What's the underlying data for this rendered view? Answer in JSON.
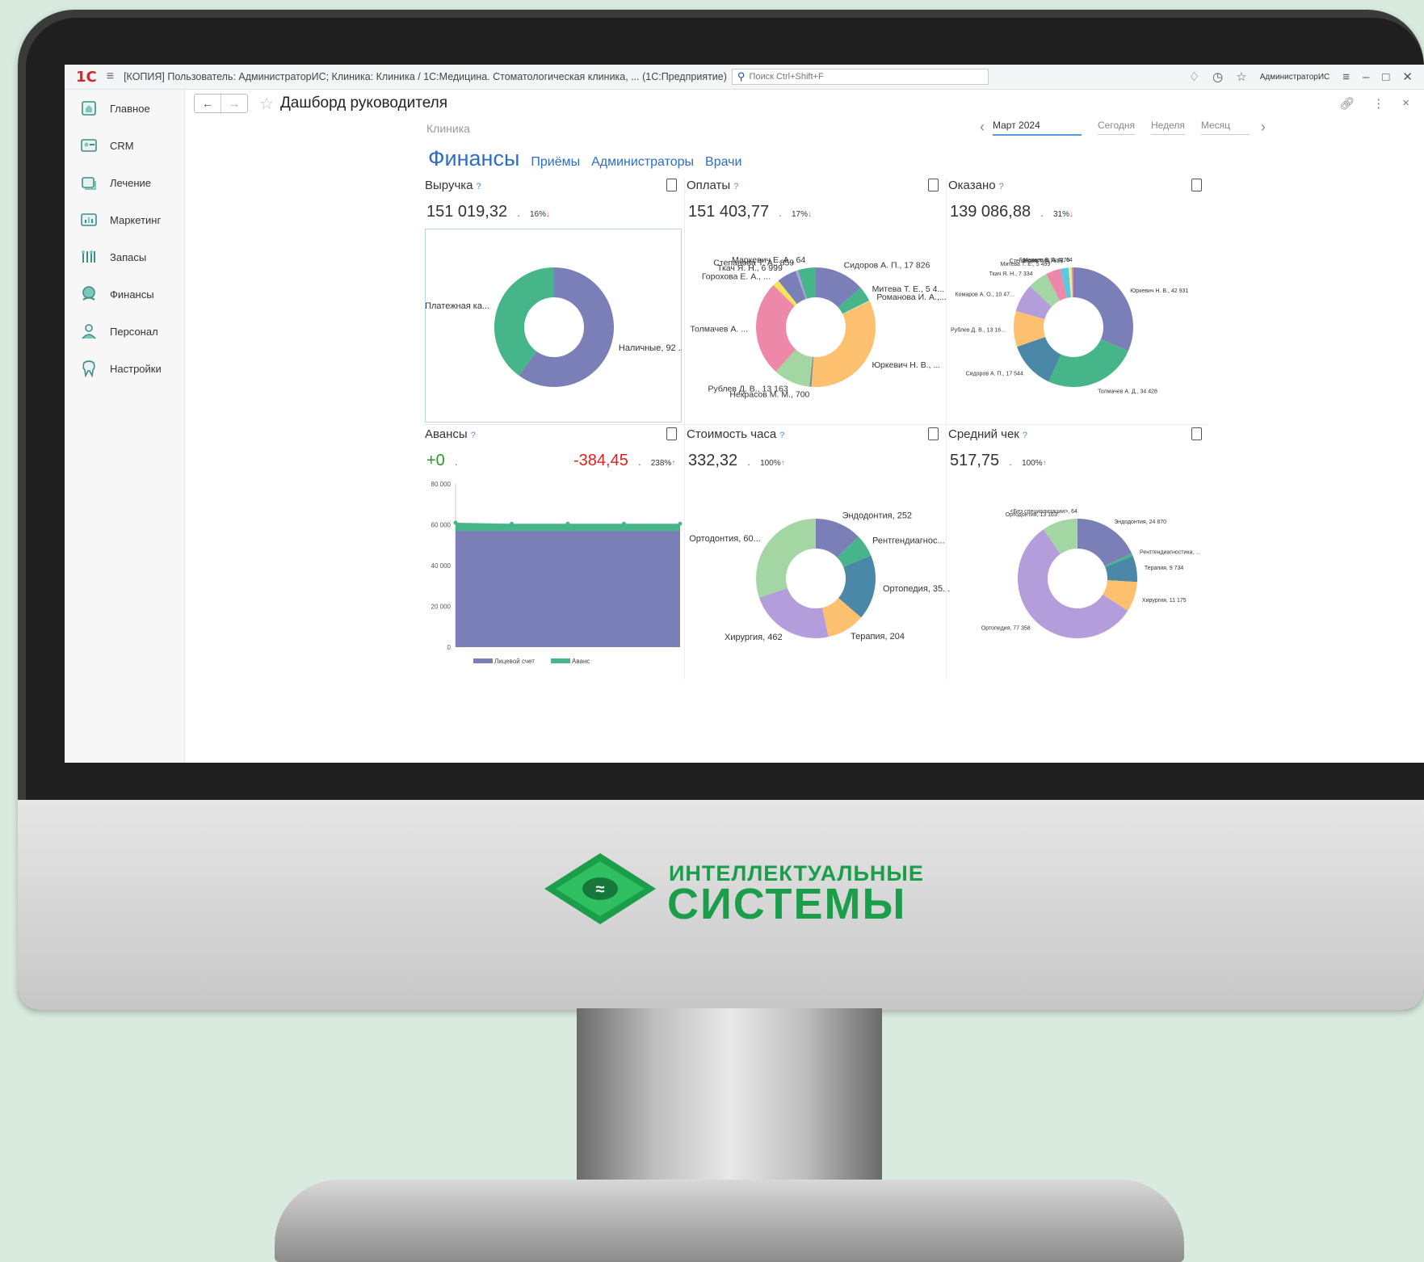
{
  "window": {
    "logo": "1С",
    "title": "[КОПИЯ] Пользователь: АдминистраторИС; Клиника: Клиника / 1С:Медицина. Стоматологическая клиника, ...  (1С:Предприятие)",
    "search_placeholder": "Поиск Ctrl+Shift+F",
    "user": "АдминистраторИС"
  },
  "sidebar": {
    "items": [
      {
        "label": "Главное",
        "icon": "home-icon"
      },
      {
        "label": "CRM",
        "icon": "crm-icon"
      },
      {
        "label": "Лечение",
        "icon": "treatment-icon"
      },
      {
        "label": "Маркетинг",
        "icon": "marketing-icon"
      },
      {
        "label": "Запасы",
        "icon": "stock-icon"
      },
      {
        "label": "Финансы",
        "icon": "finance-icon"
      },
      {
        "label": "Персонал",
        "icon": "staff-icon"
      },
      {
        "label": "Настройки",
        "icon": "settings-icon"
      }
    ]
  },
  "page": {
    "title": "Дашборд руководителя",
    "clinic": "Клиника",
    "period": {
      "selected": "Март 2024",
      "options": [
        "Сегодня",
        "Неделя",
        "Месяц"
      ]
    },
    "tabs": [
      "Финансы",
      "Приёмы",
      "Администраторы",
      "Врачи"
    ]
  },
  "colors": {
    "purple": "#7b7fb8",
    "green": "#47b58a",
    "orange": "#fdc06f",
    "pink": "#ee88a8",
    "lightgreen": "#a4d6a4",
    "teal": "#4b88a8",
    "lilac": "#b49ddb",
    "yellow": "#f5e45a",
    "accent": "#2a6ec8",
    "brand": "#1a9e4a"
  },
  "panels": {
    "revenue": {
      "title": "Выручка",
      "value": "151 019,32",
      "percent": "16%",
      "trend": "down"
    },
    "payments": {
      "title": "Оплаты",
      "value": "151 403,77",
      "percent": "17%",
      "trend": "down"
    },
    "rendered": {
      "title": "Оказано",
      "value": "139 086,88",
      "percent": "31%",
      "trend": "down"
    },
    "advances": {
      "title": "Авансы",
      "value": "+0",
      "value2": "-384,45",
      "percent": "238%",
      "trend": "up"
    },
    "hour_cost": {
      "title": "Стоимость часа",
      "value": "332,32",
      "percent": "100%",
      "trend": "up"
    },
    "avg_check": {
      "title": "Средний чек",
      "value": "517,75",
      "percent": "100%",
      "trend": "up"
    }
  },
  "chart_data": [
    {
      "id": "revenue",
      "type": "pie",
      "series": [
        {
          "name": "Наличные, 92 ...",
          "value": 60,
          "color": "#7b7fb8"
        },
        {
          "name": "Платежная ка...",
          "value": 40,
          "color": "#47b58a"
        }
      ]
    },
    {
      "id": "payments",
      "type": "pie",
      "series": [
        {
          "name": "Сидоров А. П., 17 826",
          "value": 17826,
          "color": "#7b7fb8"
        },
        {
          "name": "Митева Т. Е., 5 4...",
          "value": 5400,
          "color": "#47b58a"
        },
        {
          "name": "Романова И. А.,...",
          "value": 300,
          "color": "#d0d0d0"
        },
        {
          "name": "Юркевич Н. В., ...",
          "value": 44000,
          "color": "#fdc06f"
        },
        {
          "name": "Некрасов М. М., 700",
          "value": 700,
          "color": "#8a8a8a"
        },
        {
          "name": "Рублев Д. В., 13 163",
          "value": 13163,
          "color": "#a4d6a4"
        },
        {
          "name": "Толмачев А. ...",
          "value": 34000,
          "color": "#ee88a8"
        },
        {
          "name": "Горохова Е. А., ...",
          "value": 2300,
          "color": "#f5e45a"
        },
        {
          "name": "Ткач Я. Н., 6 999",
          "value": 6999,
          "color": "#7b7fb8"
        },
        {
          "name": "Степанова Т. А., 859",
          "value": 859,
          "color": "#b49ddb"
        },
        {
          "name": "Маркевич Е. А., 64",
          "value": 6400,
          "color": "#47b58a"
        }
      ]
    },
    {
      "id": "rendered",
      "type": "pie",
      "series": [
        {
          "name": "Юркевич Н. В., 42 931",
          "value": 42931,
          "color": "#7b7fb8"
        },
        {
          "name": "Толмачев А. Д., 34 428",
          "value": 34428,
          "color": "#47b58a"
        },
        {
          "name": "Сидоров А. П., 17 544",
          "value": 17544,
          "color": "#4b88a8"
        },
        {
          "name": "Рублев Д. В., 13 16...",
          "value": 13160,
          "color": "#fdc06f"
        },
        {
          "name": "Комаров А. О., 10 47...",
          "value": 10470,
          "color": "#b49ddb"
        },
        {
          "name": "Ткач Я. Н., 7 334",
          "value": 7334,
          "color": "#a4d6a4"
        },
        {
          "name": "Митева Т. Е., 5 499",
          "value": 5499,
          "color": "#ee88a8"
        },
        {
          "name": "Степанова Т. А., 859",
          "value": 3000,
          "color": "#5bc8e0"
        },
        {
          "name": "Горохова Е. А., 270",
          "value": 1200,
          "color": "#e8e8a0"
        },
        {
          "name": "Маркевич Е. А., 64",
          "value": 600,
          "color": "#d88aa8"
        }
      ]
    },
    {
      "id": "hour_cost",
      "type": "pie",
      "series": [
        {
          "name": "Эндодонтия, 252",
          "value": 252,
          "color": "#7b7fb8"
        },
        {
          "name": "Рентгендиагнос...",
          "value": 120,
          "color": "#47b58a"
        },
        {
          "name": "Ортопедия, 35...",
          "value": 350,
          "color": "#4b88a8"
        },
        {
          "name": "Терапия, 204",
          "value": 204,
          "color": "#fdc06f"
        },
        {
          "name": "Хирургия, 462",
          "value": 462,
          "color": "#b49ddb"
        },
        {
          "name": "Ортодонтия, 60...",
          "value": 600,
          "color": "#a4d6a4"
        }
      ]
    },
    {
      "id": "avg_check",
      "type": "pie",
      "series": [
        {
          "name": "Эндодонтия, 24 870",
          "value": 24870,
          "color": "#7b7fb8"
        },
        {
          "name": "Рентгендиагностика, ...",
          "value": 1000,
          "color": "#47b58a"
        },
        {
          "name": "Терапия, 9 734",
          "value": 9734,
          "color": "#4b88a8"
        },
        {
          "name": "Хирургия, 11 175",
          "value": 11175,
          "color": "#fdc06f"
        },
        {
          "name": "Ортопедия, 77 358",
          "value": 77358,
          "color": "#b49ddb"
        },
        {
          "name": "Ортодонтия, 13 163",
          "value": 13163,
          "color": "#a4d6a4"
        },
        {
          "name": "<Без специализации>, 64",
          "value": 64,
          "color": "#ee88a8"
        }
      ]
    },
    {
      "id": "advances",
      "type": "area",
      "ylim": [
        0,
        80000
      ],
      "yticks": [
        "0",
        "20 000",
        "40 000",
        "60 000",
        "80 000"
      ],
      "series": [
        {
          "name": "Лицевой счет",
          "color": "#7b7fb8",
          "values": [
            57000,
            57000,
            57000,
            57000,
            57000
          ]
        },
        {
          "name": "Аванс",
          "color": "#47b58a",
          "values": [
            61000,
            60500,
            60500,
            60500,
            60500
          ]
        }
      ]
    }
  ],
  "brand": {
    "line1": "ИНТЕЛЛЕКТУАЛЬНЫЕ",
    "line2": "СИСТЕМЫ"
  }
}
